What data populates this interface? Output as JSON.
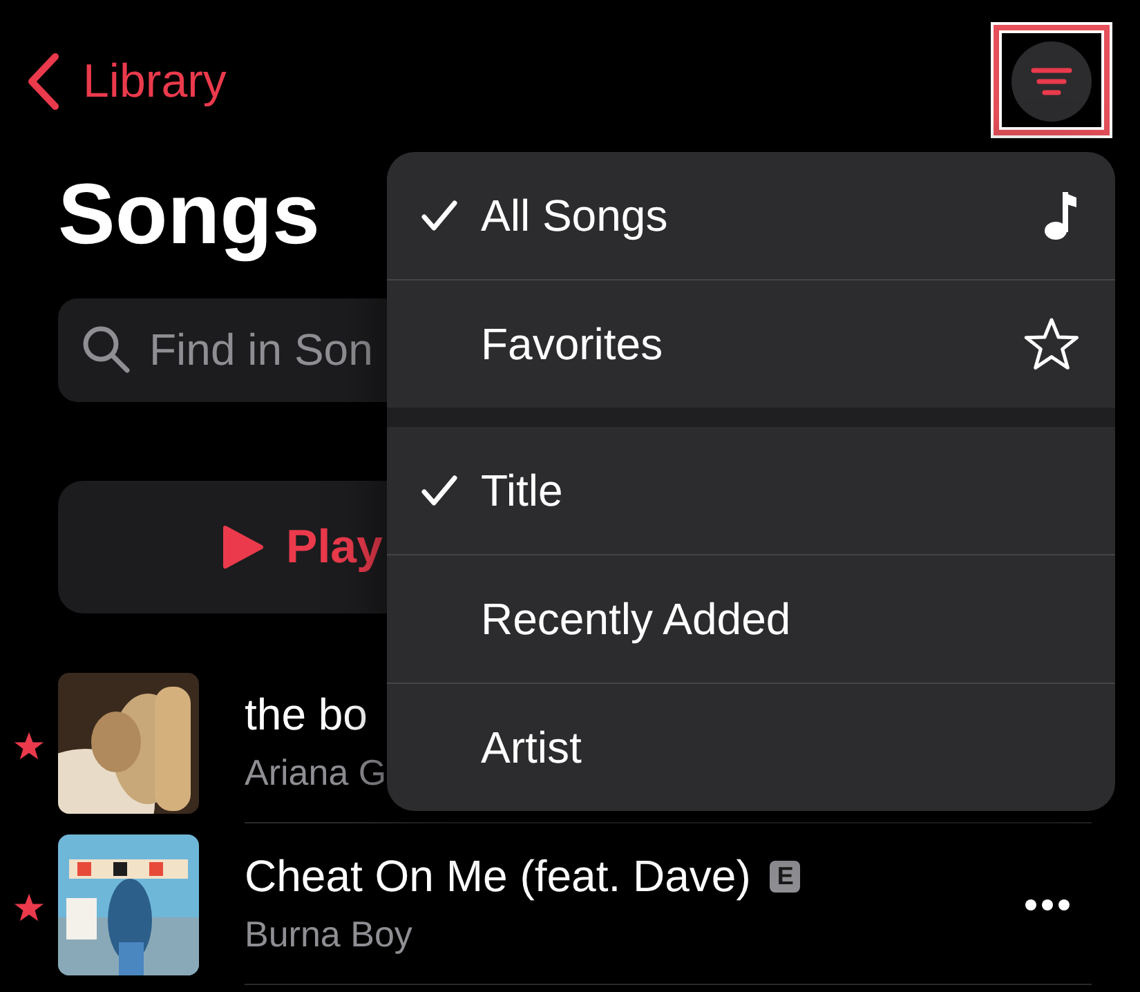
{
  "nav": {
    "back_label": "Library"
  },
  "title": "Songs",
  "search": {
    "placeholder": "Find in Son"
  },
  "play_button": {
    "label": "Play"
  },
  "songs": [
    {
      "title": "the bo",
      "artist": "Ariana G",
      "favorite": true
    },
    {
      "title": "Cheat On Me (feat. Dave)",
      "artist": "Burna Boy",
      "favorite": true,
      "explicit_label": "E",
      "more": true
    }
  ],
  "menu": {
    "sections": [
      {
        "items": [
          {
            "label": "All Songs",
            "checked": true
          },
          {
            "label": "Favorites",
            "checked": false
          }
        ]
      },
      {
        "items": [
          {
            "label": "Title",
            "checked": true
          },
          {
            "label": "Recently Added",
            "checked": false
          },
          {
            "label": "Artist",
            "checked": false
          }
        ]
      }
    ]
  },
  "highlight": true
}
